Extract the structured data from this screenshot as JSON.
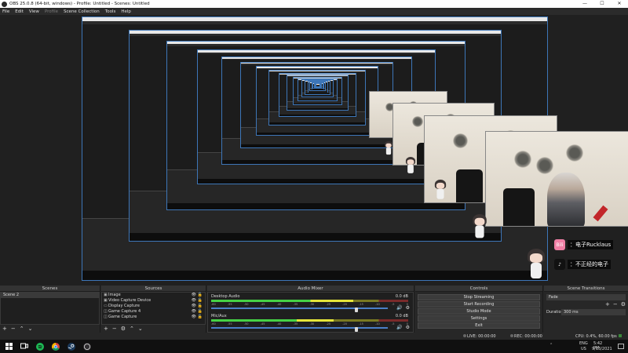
{
  "window": {
    "title": "OBS 25.0.8 (64-bit, windows) - Profile: Untitled - Scenes: Untitled",
    "minimize": "—",
    "maximize": "☐",
    "close": "✕"
  },
  "menu": {
    "items": [
      "File",
      "Edit",
      "View",
      "Profile",
      "Scene Collection",
      "Tools",
      "Help"
    ]
  },
  "overlay": {
    "social1": {
      "icon": "Bili",
      "text": "：电子Rucklaus",
      "color": "#ef7fa5"
    },
    "social2": {
      "icon": "♪",
      "text": "：不正经的电子",
      "color": "#111111"
    }
  },
  "docks": {
    "scenes": {
      "title": "Scenes",
      "items": [
        "Scene 2"
      ],
      "toolbar": [
        "+",
        "−",
        "⌃",
        "⌄"
      ]
    },
    "sources": {
      "title": "Sources",
      "items": [
        {
          "icon": "▣",
          "name": "Image"
        },
        {
          "icon": "▣",
          "name": "Video Capture Device"
        },
        {
          "icon": "▭",
          "name": "Display Capture"
        },
        {
          "icon": "◫",
          "name": "Game Capture 4"
        },
        {
          "icon": "◫",
          "name": "Game Capture"
        }
      ],
      "eye": "👁",
      "lock": "🔓",
      "toolbar": [
        "+",
        "−",
        "⚙",
        "⌃",
        "⌄"
      ]
    },
    "mixer": {
      "title": "Audio Mixer",
      "tracks": [
        {
          "name": "Desktop Audio",
          "db": "0.0 dB",
          "level": 0.72,
          "fader": 0.82
        },
        {
          "name": "Mic/Aux",
          "db": "0.0 dB",
          "level": 0.62,
          "fader": 0.82
        }
      ],
      "ticks": [
        "-60",
        "-55",
        "-50",
        "-45",
        "-40",
        "-35",
        "-30",
        "-25",
        "-20",
        "-15",
        "-10",
        "-5",
        "0"
      ],
      "speaker_icon": "🔊",
      "gear_icon": "⚙"
    },
    "controls": {
      "title": "Controls",
      "buttons": [
        "Stop Streaming",
        "Start Recording",
        "Studio Mode",
        "Settings",
        "Exit"
      ]
    },
    "transitions": {
      "title": "Scene Transitions",
      "selected": "Fade",
      "add": "+",
      "remove": "−",
      "gear": "⚙",
      "duration_label": "Duration",
      "duration_value": "300 ms"
    }
  },
  "status": {
    "live": "LIVE: 00:00:00",
    "rec": "REC: 00:00:00",
    "cpu": "CPU: 0.4%, 60.00 fps"
  },
  "taskbar": {
    "lang1": "ENG",
    "lang2": "US",
    "time": "5:42 PM",
    "date": "9/13/2021",
    "tray_arrow": "⌃"
  }
}
